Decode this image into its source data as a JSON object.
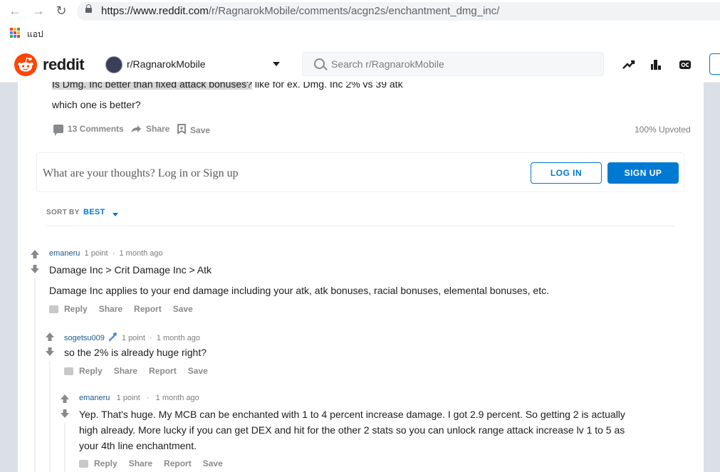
{
  "browser": {
    "url_host": "https://www.reddit.com",
    "url_path": "/r/RagnarokMobile/comments/acgn2s/enchantment_dmg_inc/",
    "bookmarks_apps_label": "แอป"
  },
  "header": {
    "logo_text": "reddit",
    "subreddit": "r/RagnarokMobile",
    "search_placeholder": "Search r/RagnarokMobile"
  },
  "post": {
    "title_highlighted": "Is Dmg. Inc better than fixed attack bonuses?",
    "title_rest": " like for ex. Dmg. Inc 2% vs 39 atk",
    "body": "which one is better?",
    "comments_label": "13 Comments",
    "share_label": "Share",
    "save_label": "Save",
    "upvoted": "100% Upvoted"
  },
  "comment_box": {
    "prompt": "What are your thoughts? Log in or Sign up",
    "login_label": "LOG IN",
    "signup_label": "SIGN UP"
  },
  "sort": {
    "label": "SORT BY",
    "value": "BEST"
  },
  "comments": [
    {
      "author": "emaneru",
      "points": "1 point",
      "sep": "·",
      "time": "1 month ago",
      "lines": [
        "Damage Inc > Crit Damage Inc > Atk",
        "Damage Inc applies to your end damage including your atk, atk bonuses, racial bonuses, elemental bonuses, etc."
      ],
      "actions": [
        "Reply",
        "Share",
        "Report",
        "Save"
      ]
    },
    {
      "author": "sogetsu009",
      "points": "1 point",
      "sep": "·",
      "time": "1 month ago",
      "lines": [
        "so the 2% is already huge right?"
      ],
      "actions": [
        "Reply",
        "Share",
        "Report",
        "Save"
      ]
    },
    {
      "author": "emaneru",
      "points": "1 point",
      "sep": "·",
      "time": "1 month ago",
      "lines": [
        "Yep. That's huge. My MCB can be enchanted with 1 to 4 percent increase damage. I got 2.9 percent. So getting 2 is actually",
        "high already. More lucky if you can get DEX and hit for the other 2 stats so you can unlock range attack increase lv 1 to 5 as",
        "your 4th line enchantment."
      ],
      "actions": [
        "Reply",
        "Share",
        "Report",
        "Save"
      ]
    }
  ]
}
